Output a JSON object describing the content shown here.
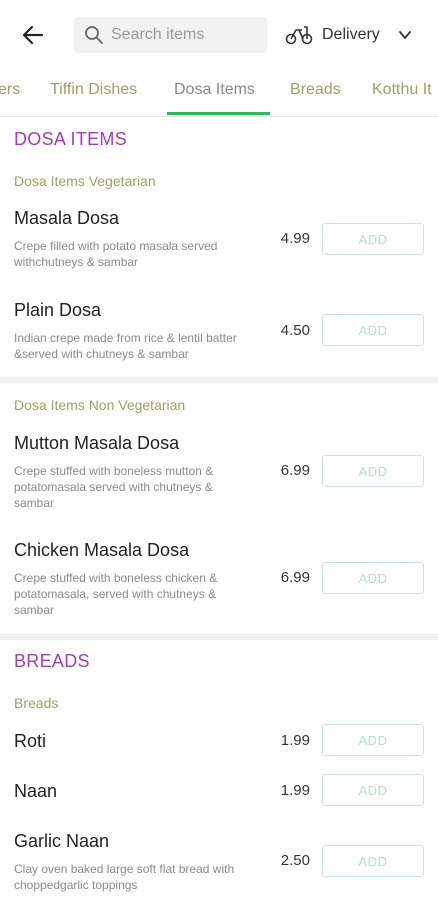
{
  "header": {
    "search_placeholder": "Search items",
    "mode_label": "Delivery"
  },
  "tabs": [
    {
      "label": "ers"
    },
    {
      "label": "Tiffin Dishes"
    },
    {
      "label": "Dosa Items"
    },
    {
      "label": "Breads"
    },
    {
      "label": "Kotthu It"
    }
  ],
  "active_tab": "Dosa Items",
  "add_label": "ADD",
  "sections": [
    {
      "title": "DOSA ITEMS",
      "subcategories": [
        {
          "name": "Dosa Items Vegetarian",
          "items": [
            {
              "name": "Masala Dosa",
              "desc": "Crepe filled with potato masala served withchutneys & sambar",
              "price": "4.99"
            },
            {
              "name": "Plain Dosa",
              "desc": "Indian crepe made from rice & lentil batter &served with chutneys & sambar",
              "price": "4.50"
            }
          ]
        },
        {
          "name": "Dosa Items Non Vegetarian",
          "items": [
            {
              "name": "Mutton Masala Dosa",
              "desc": "Crepe stuffed with boneless mutton & potatomasala served with chutneys & sambar",
              "price": "6.99"
            },
            {
              "name": "Chicken Masala Dosa",
              "desc": "Crepe stuffed with boneless chicken & potatomasala, served with chutneys & sambar",
              "price": "6.99"
            }
          ]
        }
      ]
    },
    {
      "title": "BREADS",
      "subcategories": [
        {
          "name": "Breads",
          "items": [
            {
              "name": "Roti",
              "desc": "",
              "price": "1.99"
            },
            {
              "name": "Naan",
              "desc": "",
              "price": "1.99"
            },
            {
              "name": "Garlic Naan",
              "desc": "Clay oven baked large soft flat bread with choppedgarlic toppings",
              "price": "2.50"
            }
          ]
        }
      ]
    }
  ],
  "colors": {
    "accent_green": "#2eb85c",
    "section_purple": "#a13fb3",
    "subcategory_gold": "#a39b68"
  }
}
